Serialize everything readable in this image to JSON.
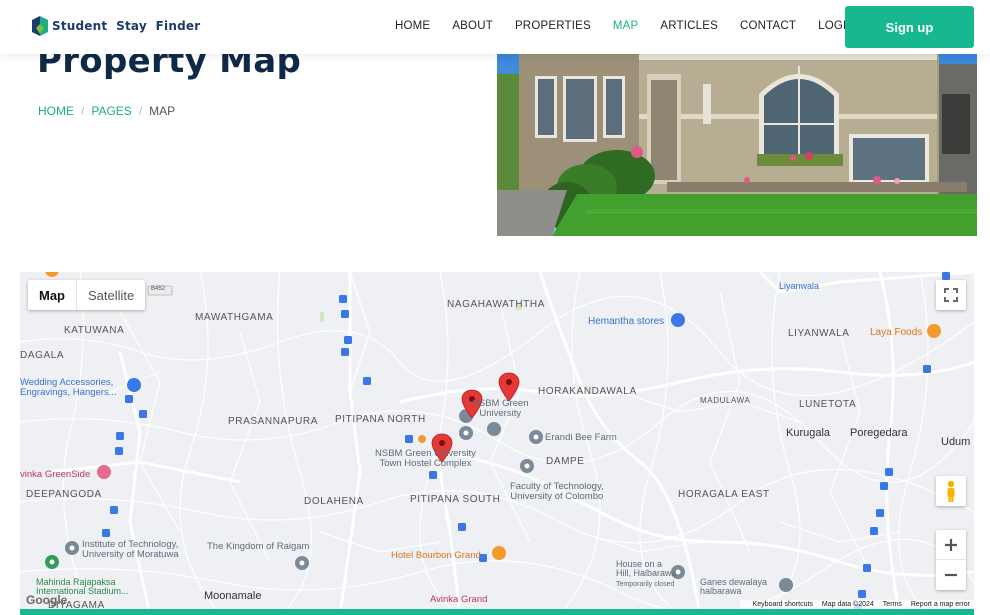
{
  "brand": {
    "name_part1": "Student",
    "name_part2": "Stay",
    "name_part3": "Finder"
  },
  "nav": {
    "items": [
      "HOME",
      "ABOUT",
      "PROPERTIES",
      "MAP",
      "ARTICLES",
      "CONTACT",
      "LOGIN"
    ],
    "active": "MAP",
    "signup_label": "Sign up"
  },
  "hero": {
    "title": "Property Map",
    "breadcrumb": [
      "HOME",
      "PAGES",
      "MAP"
    ]
  },
  "map": {
    "type_controls": [
      "Map",
      "Satellite"
    ],
    "selected_type": "Map",
    "areas": [
      "NAGAHAWATHTHA",
      "MAWATHGAMA",
      "KATUWANA",
      "DAGALA",
      "PRASANNAPURA",
      "PITIPANA NORTH",
      "HORAKANDAWALA",
      "DAMPE",
      "DEEPANGODA",
      "DOLAHENA",
      "PITIPANA SOUTH",
      "HORAGALA EAST",
      "MADULAWA",
      "LUNETOTA",
      "LIYANWALA",
      "DIYAGAMA"
    ],
    "places": {
      "liyanwala": "Liyanwala",
      "hemantha": "Hemantha stores",
      "laya": "Laya Foods",
      "wedding_1": "Wedding Accessories,",
      "wedding_2": "Engravings, Hangers...",
      "greenside": "vinka GreenSide",
      "nsbm_uni_1": "NSBM Green",
      "nsbm_uni_2": "University",
      "nsbm_hostel_1": "NSBM Green University",
      "nsbm_hostel_2": "Town Hostel Complex",
      "erandi": "Erandi Bee Farm",
      "fot_1": "Faculty of Technology,",
      "fot_2": "University of Colombo",
      "kurugala": "Kurugala",
      "poregedara": "Poregedara",
      "udum": "Udum",
      "iot_1": "Institute of Technology,",
      "iot_2": "University of Moratuwa",
      "raigam": "The Kingdom of Raigam",
      "bourbon": "Hotel Bourbon Grand",
      "halbarawa_1": "House on a",
      "halbarawa_2": "Hill, Halbarawa",
      "halbarawa_3": "Temporarily closed",
      "ganes_1": "Ganes dewalaya",
      "ganes_2": "halbarawa",
      "mahinda_1": "Mahinda Rajapaksa",
      "mahinda_2": "International Stadium...",
      "moonamale": "Moonamale",
      "avinka": "Avinka Grand",
      "road_b452": "B452"
    },
    "footer": [
      "Keyboard shortcuts",
      "Map data ©2024",
      "Terms",
      "Report a map error"
    ],
    "google_label": "Google",
    "colors": {
      "marker": "#e53935",
      "bus": "#3b78e7",
      "accent": "#17b890"
    }
  }
}
